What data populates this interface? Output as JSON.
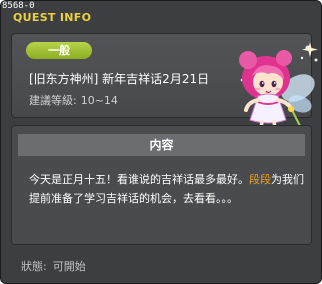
{
  "window": {
    "id_label": "8568-0",
    "title": "QUEST INFO"
  },
  "quest": {
    "category": "一般",
    "title": "[旧东方神州] 新年吉祥话2月21日",
    "level_label": "建議等級:",
    "level_range": "10~14"
  },
  "content": {
    "header": "内容",
    "text_before": "今天是正月十五！看谁说的吉祥话最多最好。",
    "highlight_name": "段段",
    "text_after": "为我们提前准备了学习吉祥话的机会，去看看。。。"
  },
  "status": {
    "label": "狀態:",
    "value": "可開始"
  },
  "colors": {
    "title": "#e9d33c",
    "badge": "#9bbd2f",
    "highlight": "#f1a21a"
  },
  "icons": {
    "npc": "pink-fairy-npc-icon"
  }
}
